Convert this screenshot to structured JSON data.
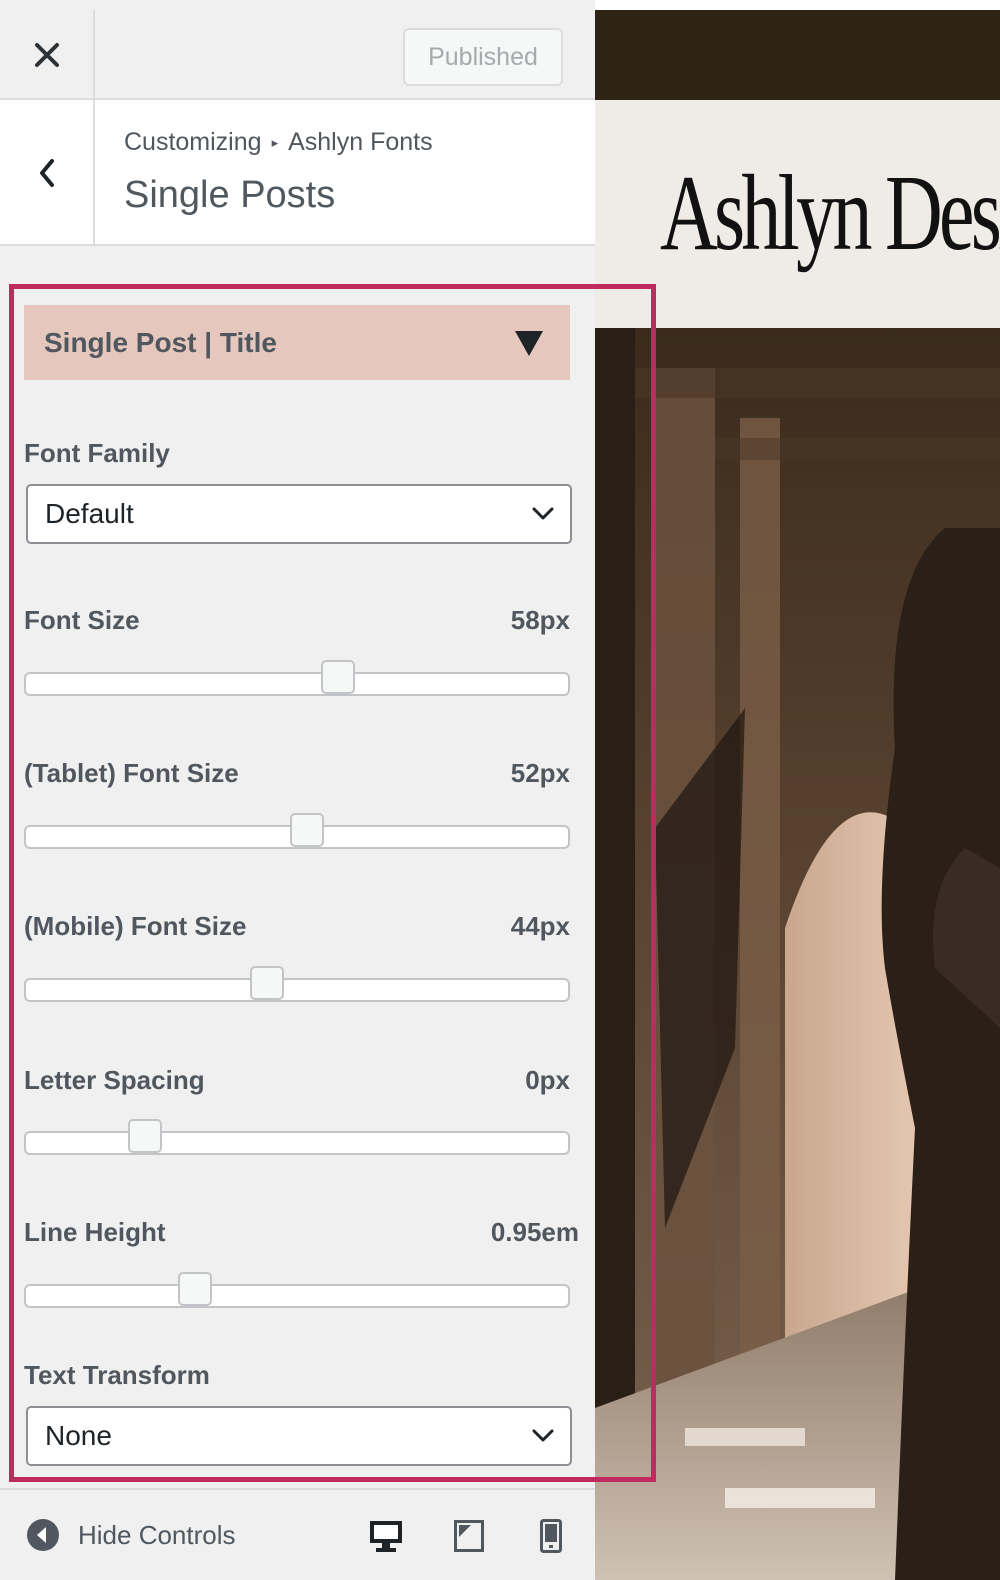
{
  "topbar": {
    "close_icon": "close-icon",
    "publish_label": "Published"
  },
  "header": {
    "back_icon": "chevron-left-icon",
    "breadcrumb_root": "Customizing",
    "breadcrumb_separator": "▸",
    "breadcrumb_parent": "Ashlyn Fonts",
    "title": "Single Posts"
  },
  "section": {
    "title": "Single Post | Title",
    "toggle_icon": "triangle-down-icon",
    "highlight_color": "#c02a5f",
    "header_color": "#e5c7bd"
  },
  "controls": {
    "font_family": {
      "label": "Font Family",
      "value": "Default"
    },
    "font_size": {
      "label": "Font Size",
      "value": "58px",
      "level": 0.58
    },
    "tablet_font_size": {
      "label": "(Tablet) Font Size",
      "value": "52px",
      "level": 0.52
    },
    "mobile_font_size": {
      "label": "(Mobile) Font Size",
      "value": "44px",
      "level": 0.44
    },
    "letter_spacing": {
      "label": "Letter Spacing",
      "value": "0px",
      "level": 0.2
    },
    "line_height": {
      "label": "Line Height",
      "value": "0.95em",
      "level": 0.3
    },
    "text_transform": {
      "label": "Text Transform",
      "value": "None"
    }
  },
  "footer": {
    "hide_controls_label": "Hide Controls",
    "devices": [
      "desktop-icon",
      "tablet-icon",
      "mobile-icon"
    ]
  },
  "preview": {
    "site_title": "Ashlyn Design"
  }
}
